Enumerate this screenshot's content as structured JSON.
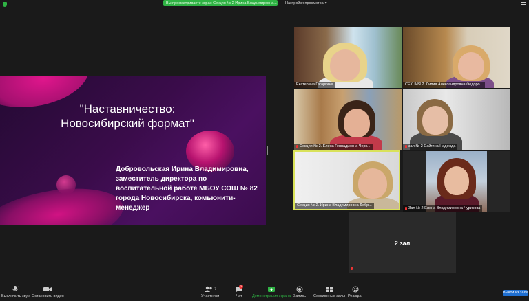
{
  "top": {
    "banner": "Вы просматриваете экран Секция № 2 Ирина Владимировна...",
    "view_options": "Настройки просмотра",
    "view_options_icon": "chevron-down-icon"
  },
  "slide": {
    "title_line1": "\"Наставничество:",
    "title_line2": "Новосибирский формат\"",
    "text_line1": "Добровольская Ирина Владимировна,",
    "text_line2": "заместитель директора по",
    "text_line3": "воспитательной работе  МБОУ СОШ № 82",
    "text_line4": "города Новосибирска, комьюнити-",
    "text_line5": "менеджер"
  },
  "participants": [
    {
      "name": "Екатерина Гагаркина"
    },
    {
      "name": "СЕКЦИЯ 2. Лилия Александровна Федоро..."
    },
    {
      "name": "Секция № 2. Елена Геннадьевна Черк..."
    },
    {
      "name": "зал № 2 Сайгина Надежда"
    },
    {
      "name": "Секция № 2. Ирина Владимировна Добр..."
    },
    {
      "name": "Зал № 2 Елена Владимировна Чурикова"
    },
    {
      "name": "2 зал"
    }
  ],
  "toolbar": {
    "mute": "Выключить звук",
    "stop_video": "Остановить видео",
    "participants": "Участники",
    "participants_count": "7",
    "chat": "Чат",
    "chat_badge": "3",
    "share_screen": "Демонстрация экрана",
    "record": "Запись",
    "breakout": "Сессионные залы",
    "reactions": "Реакции",
    "end": "Выйти из зала"
  },
  "colors": {
    "accent_green": "#2fb344",
    "end_button": "#1f6fd1",
    "active_speaker": "#d9e25a"
  }
}
